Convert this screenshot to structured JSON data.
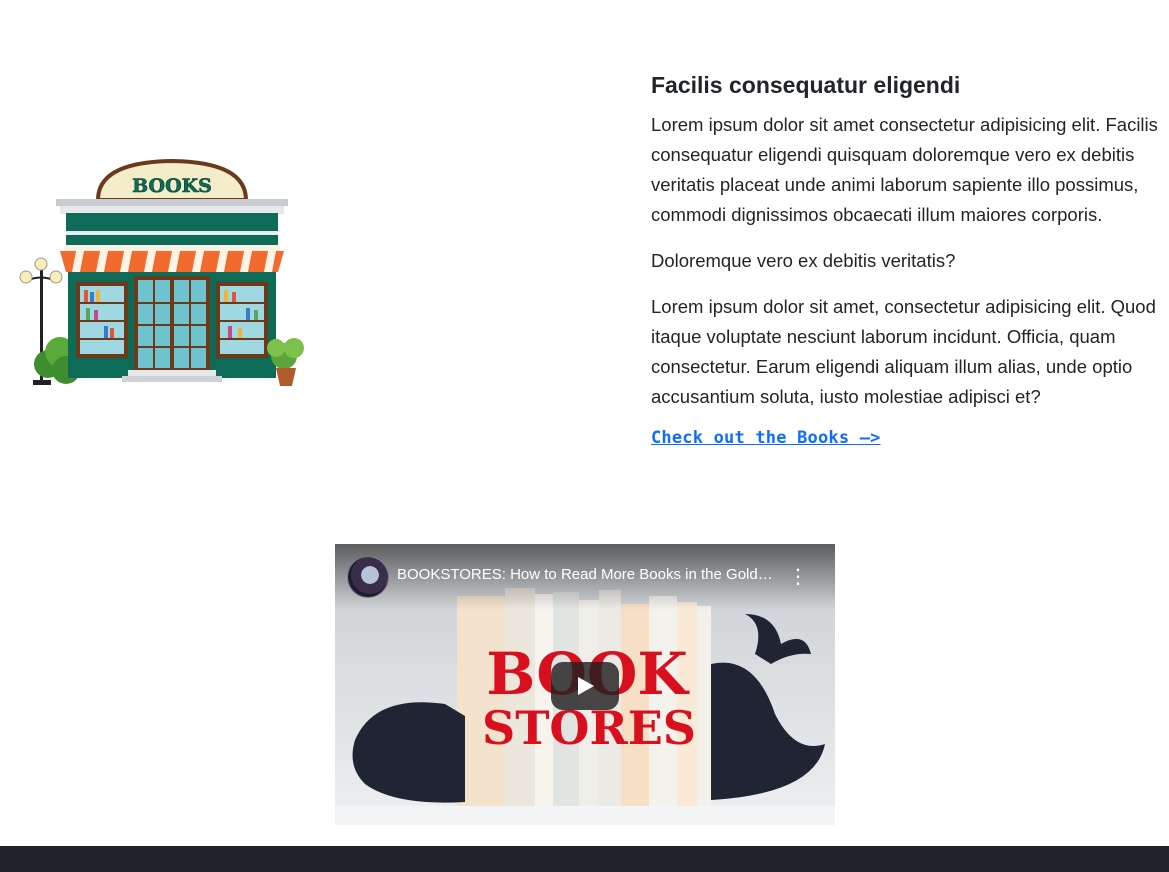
{
  "store_sign": "BOOKS",
  "article": {
    "heading": "Facilis consequatur eligendi",
    "paragraph1": "Lorem ipsum dolor sit amet consectetur adipisicing elit. Facilis consequatur eligendi quisquam doloremque vero ex debitis veritatis placeat unde animi laborum sapiente illo possimus, commodi dignissimos obcaecati illum maiores corporis.",
    "question": "Doloremque vero ex debitis veritatis?",
    "paragraph2": "Lorem ipsum dolor sit amet, consectetur adipisicing elit. Quod itaque voluptate nesciunt laborum incidunt. Officia, quam consectetur. Earum eligendi aliquam illum alias, unde optio accusantium soluta, iusto molestiae adipisci et?",
    "cta_label": "Check out the Books —>"
  },
  "video": {
    "title": "BOOKSTORES: How to Read More Books in the Golden Age of Content",
    "thumb_line1": "BOOK",
    "thumb_line2": "STORES",
    "menu_icon": "more-vert-icon",
    "play_icon": "play-icon"
  },
  "colors": {
    "link": "#0d6efd",
    "footer": "#212529",
    "thumb_text": "#d8101e",
    "store_green": "#0d6b57",
    "awning_orange": "#f26a2e"
  }
}
